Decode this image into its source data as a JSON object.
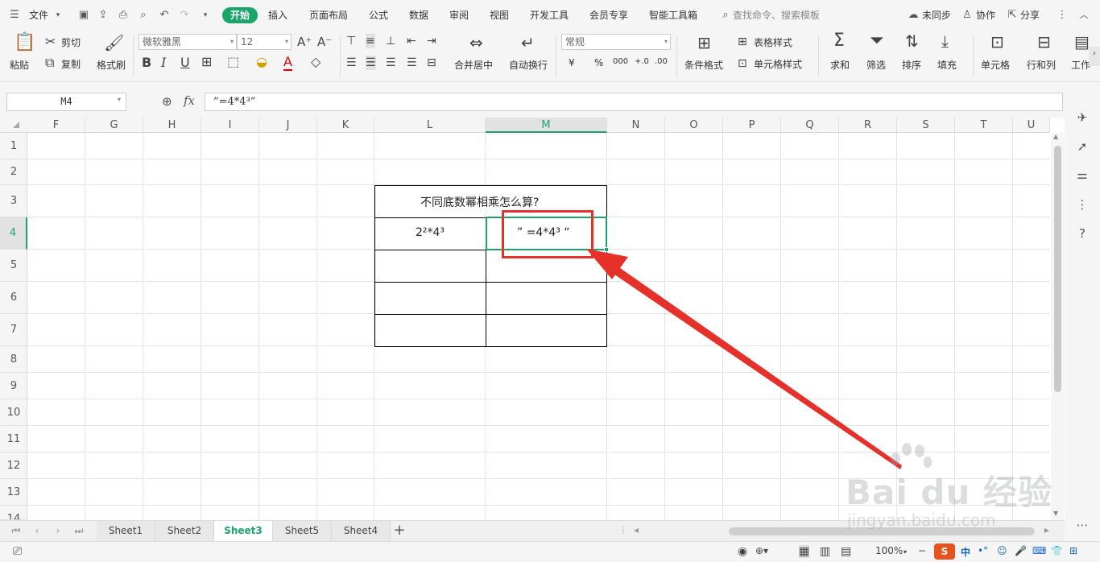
{
  "menubar": {
    "file_menu": "文件",
    "tabs": [
      "开始",
      "插入",
      "页面布局",
      "公式",
      "数据",
      "审阅",
      "视图",
      "开发工具",
      "会员专享",
      "智能工具箱"
    ],
    "active_tab": "开始",
    "search_placeholder": "查找命令、搜索模板",
    "sync_label": "未同步",
    "collab_label": "协作",
    "share_label": "分享"
  },
  "ribbon": {
    "paste": "粘贴",
    "cut": "剪切",
    "copy": "复制",
    "format_painter": "格式刷",
    "font_name": "微软雅黑",
    "font_size": "12",
    "bold": "B",
    "italic": "I",
    "underline": "U",
    "font_color_glyph": "A",
    "merge_center": "合并居中",
    "wrap_text": "自动换行",
    "number_format": "常规",
    "currency": "¥",
    "percent": "%",
    "thousands": "000",
    "inc_decimal": "+.0",
    "dec_decimal": ".00",
    "table_style": "表格样式",
    "cond_format": "条件格式",
    "cell_style": "单元格样式",
    "sum": "求和",
    "filter": "筛选",
    "sort": "排序",
    "fill": "填充",
    "cell": "单元格",
    "rows_cols": "行和列",
    "worksheet": "工作"
  },
  "formula_bar": {
    "name_box": "M4",
    "fx": "fx",
    "content": "”=4*4³“"
  },
  "columns": [
    "F",
    "G",
    "H",
    "I",
    "J",
    "K",
    "L",
    "M",
    "N",
    "O",
    "P",
    "Q",
    "R",
    "S",
    "T",
    "U"
  ],
  "selected_column": "M",
  "rows": [
    "1",
    "2",
    "3",
    "4",
    "5",
    "6",
    "7",
    "8",
    "9",
    "10",
    "11",
    "12",
    "13",
    "14"
  ],
  "selected_row": "4",
  "table": {
    "title": "不同底数幂相乘怎么算?",
    "l4": "2²*4³",
    "m4": "” =4*4³ “"
  },
  "sheets": [
    "Sheet1",
    "Sheet2",
    "Sheet3",
    "Sheet5",
    "Sheet4"
  ],
  "active_sheet": "Sheet3",
  "statusbar": {
    "zoom": "100%",
    "ime_lang": "中"
  },
  "watermark": {
    "brand": "Bai du 经验",
    "url": "jingyan.baidu.com"
  },
  "colors": {
    "accent": "#1aa56b",
    "annotation_red": "#e6302a"
  }
}
